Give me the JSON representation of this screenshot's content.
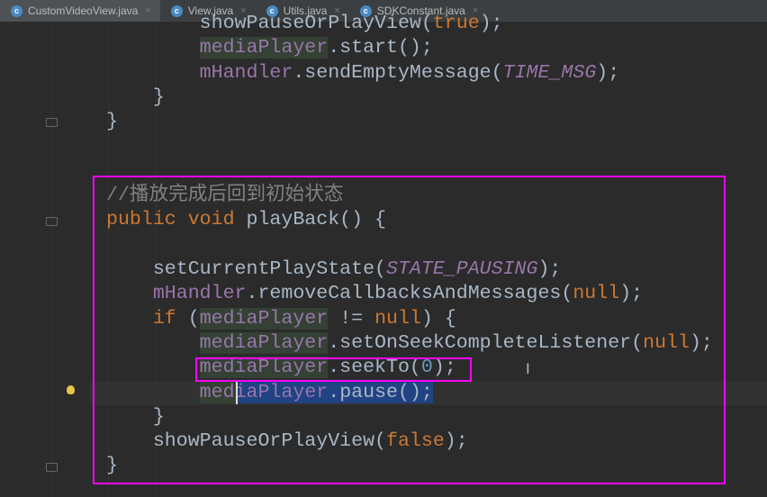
{
  "tabs": [
    {
      "label": "CustomVideoView.java",
      "icon": "class-icon",
      "close": "×",
      "active": true
    },
    {
      "label": "View.java",
      "icon": "class-icon",
      "close": "×",
      "active": false
    },
    {
      "label": "Utils.java",
      "icon": "class-icon",
      "close": "×",
      "active": false
    },
    {
      "label": "SDKConstant.java",
      "icon": "class-icon",
      "close": "×",
      "active": false
    }
  ],
  "code": [
    {
      "indent": 8,
      "tokens": [
        [
          "",
          "showPauseOrPlayView("
        ],
        [
          "kw",
          "true"
        ],
        [
          "",
          ");"
        ]
      ]
    },
    {
      "indent": 8,
      "tokens": [
        [
          "idbg",
          "mediaPlayer"
        ],
        [
          "",
          ".start();"
        ]
      ]
    },
    {
      "indent": 8,
      "tokens": [
        [
          "id",
          "mHandler"
        ],
        [
          "",
          ".sendEmptyMessage("
        ],
        [
          "const",
          "TIME_MSG"
        ],
        [
          "",
          ");"
        ]
      ]
    },
    {
      "indent": 4,
      "tokens": [
        [
          "",
          "}"
        ]
      ]
    },
    {
      "indent": 0,
      "tokens": [
        [
          "",
          "}"
        ]
      ]
    },
    {
      "indent": 0,
      "tokens": []
    },
    {
      "indent": 0,
      "tokens": []
    },
    {
      "indent": 0,
      "tokens": [
        [
          "cm",
          "//播放完成后回到初始状态"
        ]
      ]
    },
    {
      "indent": 0,
      "tokens": [
        [
          "kw",
          "public void "
        ],
        [
          "",
          "playBack() {"
        ]
      ]
    },
    {
      "indent": 0,
      "tokens": []
    },
    {
      "indent": 4,
      "tokens": [
        [
          "",
          "setCurrentPlayState("
        ],
        [
          "const",
          "STATE_PAUSING"
        ],
        [
          "",
          ");"
        ]
      ]
    },
    {
      "indent": 4,
      "tokens": [
        [
          "id",
          "mHandler"
        ],
        [
          "",
          ".removeCallbacksAndMessages("
        ],
        [
          "kw",
          "null"
        ],
        [
          "",
          ");"
        ]
      ]
    },
    {
      "indent": 4,
      "tokens": [
        [
          "kw",
          "if "
        ],
        [
          "",
          "("
        ],
        [
          "idbg",
          "mediaPlayer"
        ],
        [
          "",
          " != "
        ],
        [
          "kw",
          "null"
        ],
        [
          "",
          ") {"
        ]
      ]
    },
    {
      "indent": 8,
      "tokens": [
        [
          "idbg",
          "mediaPlayer"
        ],
        [
          "",
          ".setOnSeekCompleteListener("
        ],
        [
          "kw",
          "null"
        ],
        [
          "",
          ");"
        ]
      ]
    },
    {
      "indent": 8,
      "tokens": [
        [
          "idbg",
          "mediaPlayer"
        ],
        [
          "",
          ".seekTo("
        ],
        [
          "num",
          "0"
        ],
        [
          "",
          ");"
        ]
      ]
    },
    {
      "indent": 8,
      "tokens": [
        [
          "idbg",
          "med"
        ],
        [
          "idsel",
          "iaPlayer"
        ],
        [
          "sel",
          ".pause();"
        ]
      ]
    },
    {
      "indent": 4,
      "tokens": [
        [
          "",
          "}"
        ]
      ]
    },
    {
      "indent": 4,
      "tokens": [
        [
          "",
          "showPauseOrPlayView("
        ],
        [
          "kw",
          "false"
        ],
        [
          "",
          ");"
        ]
      ]
    },
    {
      "indent": 0,
      "tokens": [
        [
          "",
          "}"
        ]
      ]
    }
  ]
}
